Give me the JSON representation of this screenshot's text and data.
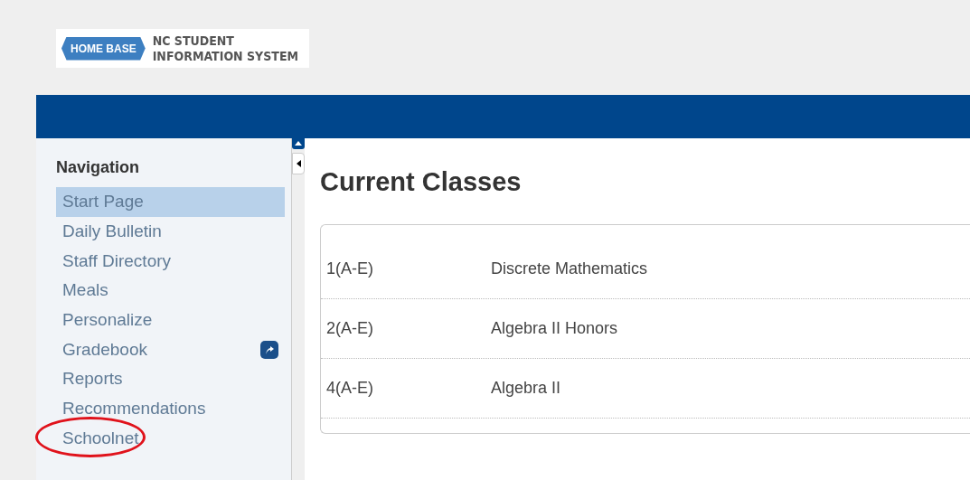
{
  "logo": {
    "badge": "HOME BASE",
    "line1": "NC STUDENT",
    "line2": "INFORMATION SYSTEM"
  },
  "navigation": {
    "title": "Navigation",
    "items": [
      {
        "label": "Start Page",
        "selected": true,
        "launch": false,
        "highlighted": false
      },
      {
        "label": "Daily Bulletin",
        "selected": false,
        "launch": false,
        "highlighted": false
      },
      {
        "label": "Staff Directory",
        "selected": false,
        "launch": false,
        "highlighted": false
      },
      {
        "label": "Meals",
        "selected": false,
        "launch": false,
        "highlighted": false
      },
      {
        "label": "Personalize",
        "selected": false,
        "launch": false,
        "highlighted": false
      },
      {
        "label": "Gradebook",
        "selected": false,
        "launch": true,
        "highlighted": false
      },
      {
        "label": "Reports",
        "selected": false,
        "launch": false,
        "highlighted": false
      },
      {
        "label": "Recommendations",
        "selected": false,
        "launch": false,
        "highlighted": false
      },
      {
        "label": "Schoolnet",
        "selected": false,
        "launch": false,
        "highlighted": true
      }
    ]
  },
  "main": {
    "title": "Current Classes",
    "classes": [
      {
        "period": "1(A-E)",
        "name": "Discrete Mathematics"
      },
      {
        "period": "2(A-E)",
        "name": "Algebra II Honors"
      },
      {
        "period": "4(A-E)",
        "name": "Algebra II"
      }
    ]
  }
}
